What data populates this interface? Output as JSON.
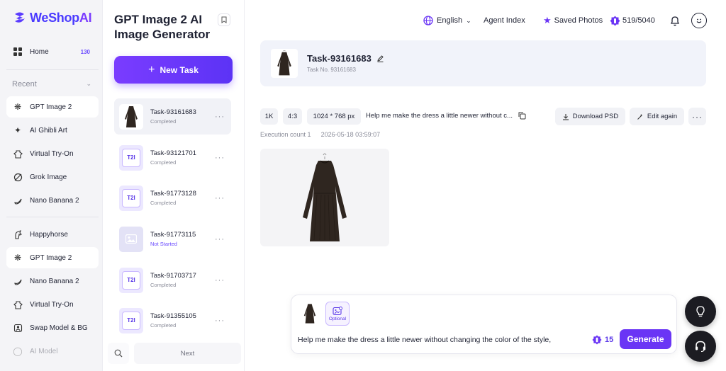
{
  "brand": {
    "name": "WeShop",
    "ai": "AI"
  },
  "sidebar": {
    "home": {
      "label": "Home",
      "badge": "130"
    },
    "recent_label": "Recent",
    "recent": [
      {
        "label": "GPT Image 2",
        "icon": "gpt-icon"
      },
      {
        "label": "AI Ghibli Art",
        "icon": "sparkle-icon"
      },
      {
        "label": "Virtual Try-On",
        "icon": "hanger-icon"
      },
      {
        "label": "Grok Image",
        "icon": "grok-icon"
      },
      {
        "label": "Nano Banana 2",
        "icon": "banana-icon"
      }
    ],
    "tools": [
      {
        "label": "Happyhorse",
        "icon": "horse-icon"
      },
      {
        "label": "GPT Image 2",
        "icon": "gpt-icon"
      },
      {
        "label": "Nano Banana 2",
        "icon": "banana-icon"
      },
      {
        "label": "Virtual Try-On",
        "icon": "hanger-icon"
      },
      {
        "label": "Swap Model & BG",
        "icon": "swap-icon"
      },
      {
        "label": "AI Model",
        "icon": "model-icon"
      }
    ]
  },
  "taskpanel": {
    "title": "GPT Image 2 AI Image Generator",
    "new_task": "New Task",
    "tasks": [
      {
        "name": "Task-93161683",
        "status": "Completed",
        "thumb": "dress"
      },
      {
        "name": "Task-93121701",
        "status": "Completed",
        "thumb": "T2I"
      },
      {
        "name": "Task-91773128",
        "status": "Completed",
        "thumb": "T2I"
      },
      {
        "name": "Task-91773115",
        "status": "Not Started",
        "thumb": "image"
      },
      {
        "name": "Task-91703717",
        "status": "Completed",
        "thumb": "T2I"
      },
      {
        "name": "Task-91355105",
        "status": "Completed",
        "thumb": "T2I"
      }
    ],
    "next": "Next"
  },
  "topbar": {
    "language": "English",
    "agent_index": "Agent Index",
    "saved_photos": "Saved Photos",
    "credits": "519/5040"
  },
  "task": {
    "title": "Task-93161683",
    "task_no": "Task No. 93161683",
    "chips": {
      "res": "1K",
      "ratio": "4:3",
      "size": "1024 * 768 px"
    },
    "prompt_short": "Help me make the dress a little newer without c...",
    "download": "Download PSD",
    "edit_again": "Edit again",
    "execution": "Execution count 1",
    "timestamp": "2026-05-18 03:59:07"
  },
  "composer": {
    "optional": "Optional",
    "text": "Help me make the dress a little newer without changing the color of the style,",
    "cost": "15",
    "generate": "Generate"
  },
  "colors": {
    "accent": "#6a35f5",
    "brand": "#4a3aff"
  }
}
